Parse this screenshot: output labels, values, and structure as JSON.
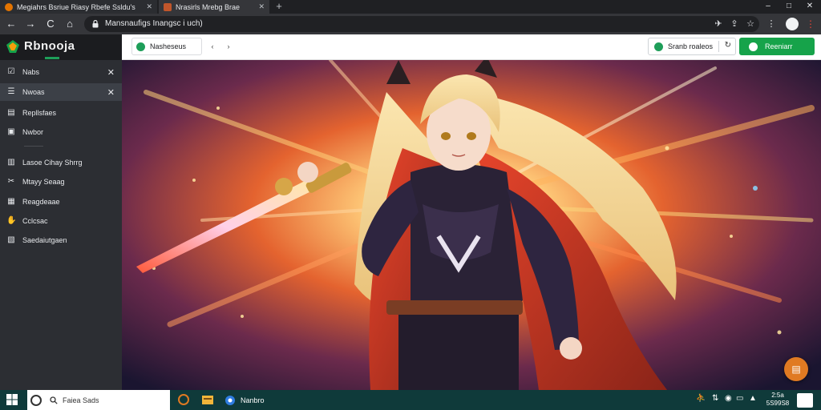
{
  "browser": {
    "tabs": [
      {
        "label": "Megiahrs Bsriue Riasy Rbefe Ssldu's",
        "active": false
      },
      {
        "label": "Nrasirls Mrebg Brae",
        "active": true
      }
    ],
    "new_tab": "+",
    "window_controls": {
      "minimize": "–",
      "maximize": "□",
      "close": "✕"
    },
    "nav": {
      "back": "←",
      "forward": "→",
      "reload": "C",
      "home": "⌂"
    },
    "url": "Mansnaufigs Inangsc i uch)"
  },
  "sidebar": {
    "logo": "Rbnooja",
    "items": [
      {
        "label": "Nabs",
        "icon": "checkbox-icon",
        "closable": true,
        "active": false
      },
      {
        "label": "Nwoas",
        "icon": "list-icon",
        "closable": true,
        "active": true
      },
      {
        "label": "Repllsfaes",
        "icon": "document-icon",
        "closable": false,
        "active": false
      },
      {
        "label": "Nwbor",
        "icon": "bookmark-icon",
        "closable": false,
        "active": false
      },
      {
        "label": "Lasoe Cihay Shrrg",
        "icon": "book-icon",
        "closable": false,
        "active": false
      },
      {
        "label": "Mtayy Seaag",
        "icon": "tools-icon",
        "closable": false,
        "active": false
      },
      {
        "label": "Reagdeaae",
        "icon": "grid-icon",
        "closable": false,
        "active": false
      },
      {
        "label": "Cclcsac",
        "icon": "hand-icon",
        "closable": false,
        "active": false
      },
      {
        "label": "Saedaiutgaen",
        "icon": "box-icon",
        "closable": false,
        "active": false
      }
    ]
  },
  "header": {
    "breadcrumb": "Nasheseus",
    "nav_prev": "‹",
    "nav_next": "›",
    "secondary_button": "Sranb roaleos",
    "primary_button": "Reeniarr"
  },
  "taskbar": {
    "search_placeholder": "Faiea Sads",
    "app_label": "Nanbro",
    "clock": "2:5a\n5S99S8"
  },
  "colors": {
    "accent_green": "#16a34a",
    "sidebar_bg": "#2c2e33",
    "fab_orange": "#e07a22"
  }
}
